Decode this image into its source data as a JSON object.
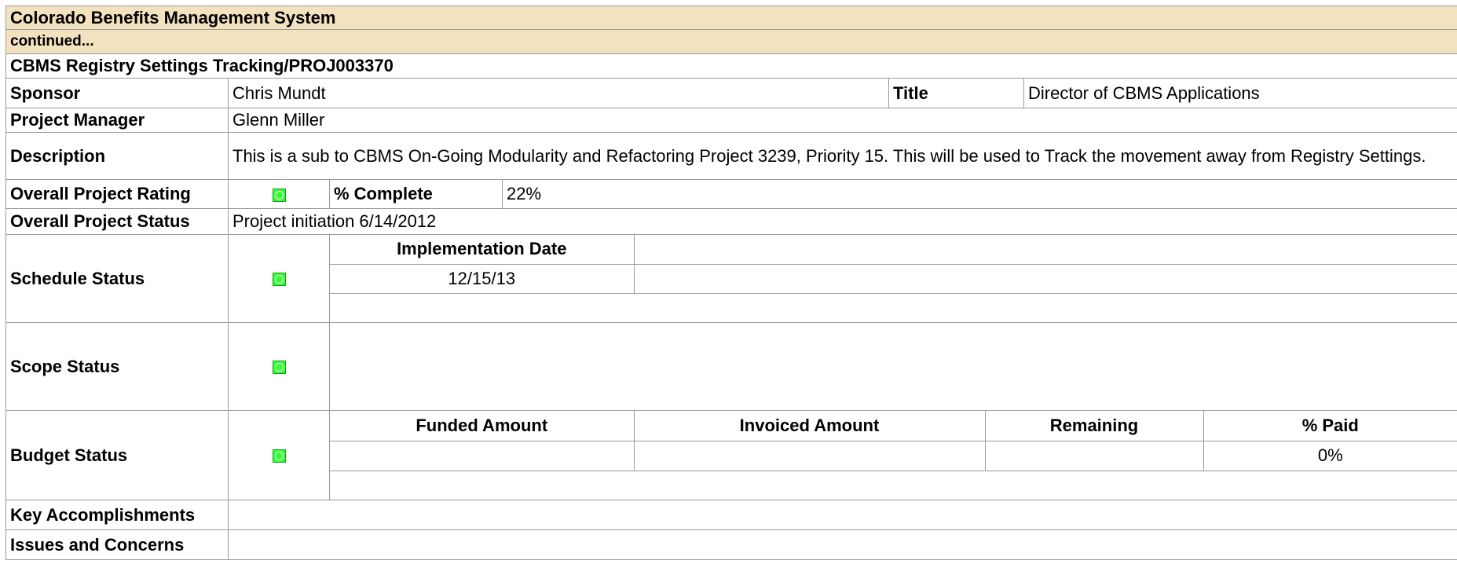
{
  "header": {
    "system_title": "Colorado Benefits Management System",
    "continued": "continued..."
  },
  "project": {
    "name": "CBMS Registry Settings Tracking/PROJ003370",
    "sponsor_label": "Sponsor",
    "sponsor": "Chris Mundt",
    "title_label": "Title",
    "title": "Director of CBMS Applications",
    "pm_label": "Project Manager",
    "pm": "Glenn Miller",
    "description_label": "Description",
    "description": "This is a sub to CBMS On-Going Modularity and Refactoring Project 3239, Priority 15. This will be used to Track the movement away from Registry Settings.",
    "rating_label": "Overall Project Rating",
    "rating_color": "#33ff33",
    "complete_label": "% Complete",
    "complete": "22%",
    "status_label": "Overall Project Status",
    "status": "Project initiation 6/14/2012"
  },
  "schedule": {
    "label": "Schedule Status",
    "impl_header": "Implementation Date",
    "impl_date": "12/15/13"
  },
  "scope": {
    "label": "Scope Status"
  },
  "budget": {
    "label": "Budget Status",
    "funded_header": "Funded Amount",
    "invoiced_header": "Invoiced Amount",
    "remaining_header": "Remaining",
    "paid_header": "% Paid",
    "funded": "",
    "invoiced": "",
    "remaining": "",
    "paid": "0%"
  },
  "accomplishments": {
    "label": "Key Accomplishments",
    "value": ""
  },
  "issues": {
    "label": "Issues and Concerns",
    "value": ""
  }
}
